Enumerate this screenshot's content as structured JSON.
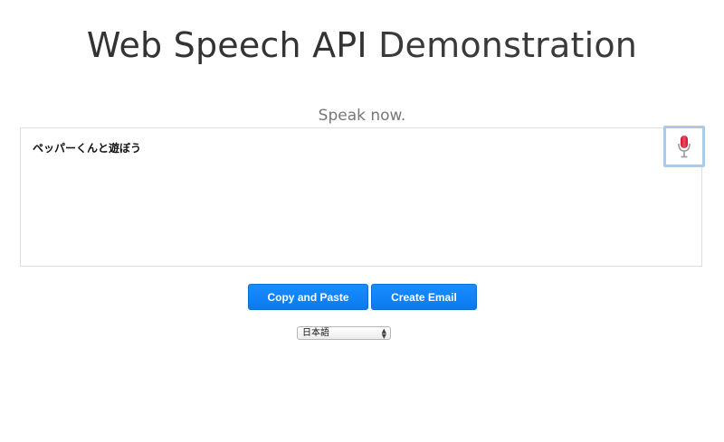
{
  "header": {
    "title_part1": "Web Speech API",
    "title_part2": "Demonstration"
  },
  "status": {
    "text": "Speak now."
  },
  "results": {
    "final_text": "ペッパーくんと遊ぼう"
  },
  "mic": {
    "icon": "microphone-icon",
    "state": "listening",
    "color": "#e8334a"
  },
  "buttons": {
    "copy_label": "Copy and Paste",
    "email_label": "Create Email"
  },
  "language": {
    "selected": "日本語"
  },
  "colors": {
    "button_blue": "#0a7bef",
    "mic_highlight": "#a7cbe8"
  }
}
